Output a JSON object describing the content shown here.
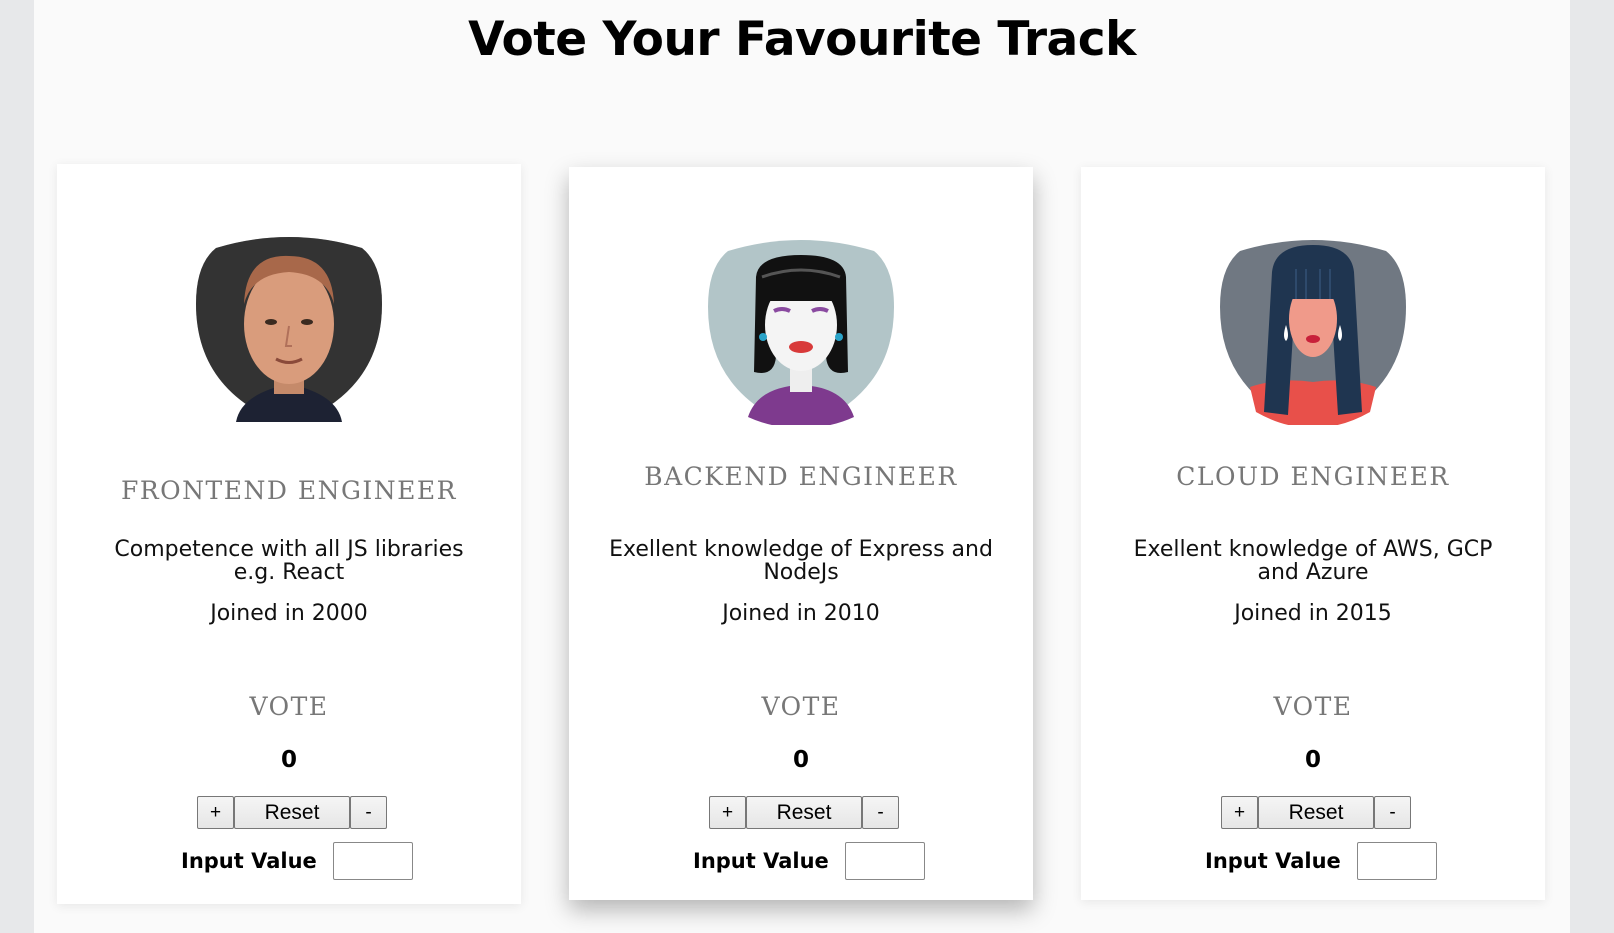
{
  "header": {
    "title": "Vote Your Favourite Track"
  },
  "cards": [
    {
      "role": "FRONTEND ENGINEER",
      "description": "Competence with all JS libraries e.g. React",
      "joined": "Joined in 2000",
      "vote_label": "VOTE",
      "count": "0",
      "plus_label": "+",
      "reset_label": "Reset",
      "minus_label": "-",
      "input_label": "Input Value",
      "input_value": ""
    },
    {
      "role": "BACKEND ENGINEER",
      "description": "Exellent knowledge of Express and NodeJs",
      "joined": "Joined in 2010",
      "vote_label": "VOTE",
      "count": "0",
      "plus_label": "+",
      "reset_label": "Reset",
      "minus_label": "-",
      "input_label": "Input Value",
      "input_value": ""
    },
    {
      "role": "CLOUD ENGINEER",
      "description": "Exellent knowledge of AWS, GCP and Azure",
      "joined": "Joined in 2015",
      "vote_label": "VOTE",
      "count": "0",
      "plus_label": "+",
      "reset_label": "Reset",
      "minus_label": "-",
      "input_label": "Input Value",
      "input_value": ""
    }
  ],
  "colors": {
    "page_bg": "#fafafa",
    "outer_bg": "#e7e8ea",
    "role_text": "#777777",
    "avatar1_bg": "#3a3a3a",
    "avatar2_bg": "#b2c5c8",
    "avatar3_bg": "#707882"
  }
}
